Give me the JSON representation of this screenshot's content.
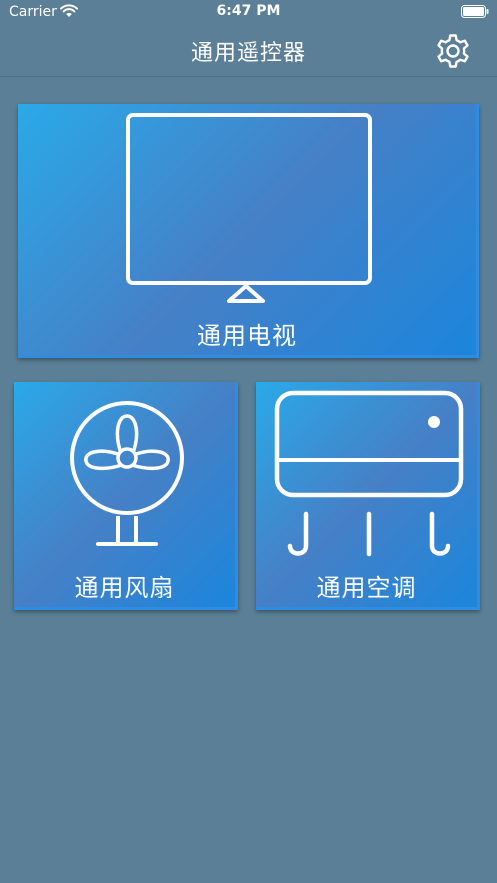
{
  "status_bar": {
    "carrier": "Carrier",
    "time": "6:47 PM",
    "wifi_icon": "wifi-icon",
    "battery_icon": "battery-icon"
  },
  "nav": {
    "title": "通用遥控器",
    "settings_icon": "gear-icon"
  },
  "cards": {
    "tv": {
      "label": "通用电视",
      "icon": "tv-icon"
    },
    "fan": {
      "label": "通用风扇",
      "icon": "fan-icon"
    },
    "ac": {
      "label": "通用空调",
      "icon": "air-conditioner-icon"
    }
  },
  "colors": {
    "background": "#5a7f96",
    "card_gradient_start": "#2aa9e8",
    "card_gradient_mid": "#4680c6",
    "card_gradient_end": "#1b86dc",
    "foreground": "#ffffff"
  }
}
